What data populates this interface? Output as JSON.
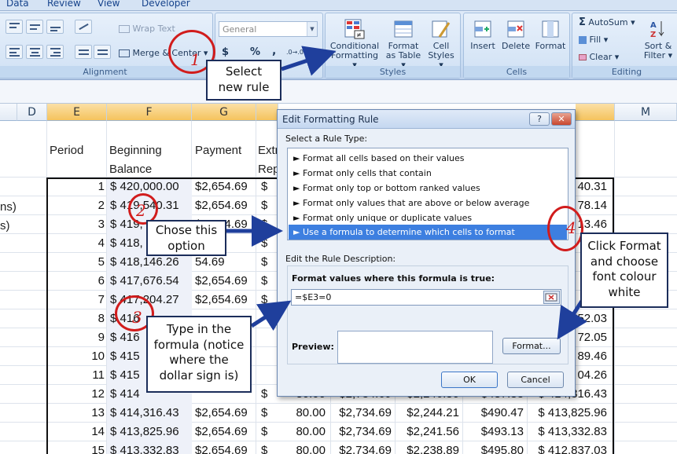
{
  "ribbon": {
    "tabs": [
      "Data",
      "Review",
      "View",
      "Developer"
    ],
    "alignment": {
      "wrap_text": "Wrap Text",
      "merge_center": "Merge & Center",
      "group_label": "Alignment"
    },
    "number": {
      "format_value": "General",
      "currency": "$",
      "percent": "%",
      "comma": ",",
      "decimals_inc": ".0→.00",
      "decimals_dec": ".00→.0"
    },
    "styles": {
      "conditional_formatting": [
        "Conditional",
        "Formatting ▾"
      ],
      "format_as_table": [
        "Format",
        "as Table ▾"
      ],
      "cell_styles": [
        "Cell",
        "Styles ▾"
      ],
      "group_label": "Styles"
    },
    "cells": {
      "insert": "Insert",
      "delete": "Delete",
      "format": "Format",
      "group_label": "Cells"
    },
    "editing": {
      "autosum": "AutoSum ▾",
      "fill": "Fill ▾",
      "clear": "Clear ▾",
      "sort_filter": [
        "Sort &",
        "Filter ▾"
      ],
      "find": [
        "Fin",
        "Sel"
      ],
      "group_label": "Editing"
    }
  },
  "sheet": {
    "columns": [
      "D",
      "E",
      "F",
      "G",
      "M"
    ],
    "headers": {
      "period": "Period",
      "beginning": "Beginning",
      "balance": "Balance",
      "payment": "Payment",
      "extra1": "Extr",
      "extra2": "Rep"
    },
    "left_labels": [
      "ns)",
      "s)"
    ],
    "rows": [
      {
        "period": "1",
        "balance": "$ 420,000.00",
        "payment": "$2,654.69",
        "c": "$",
        "m": "40.31"
      },
      {
        "period": "2",
        "balance": "$ 419,540.31",
        "payment": "$2,654.69",
        "c": "$",
        "m": "78.14"
      },
      {
        "period": "3",
        "balance": "$ 419,",
        "payment": "$2,654.69",
        "c": "$",
        "m": "13.46"
      },
      {
        "period": "4",
        "balance": "$ 418,",
        "payment": "4.69",
        "c": "$",
        "m": ""
      },
      {
        "period": "5",
        "balance": "$ 418,146.26",
        "payment": "54.69",
        "c": "$",
        "m": ""
      },
      {
        "period": "6",
        "balance": "$ 417,676.54",
        "payment": "$2,654.69",
        "c": "$",
        "m": ""
      },
      {
        "period": "7",
        "balance": "$ 417,204.27",
        "payment": "$2,654.69",
        "c": "$",
        "m": ""
      },
      {
        "period": "8",
        "balance": "$ 416",
        "payment": "",
        "c": "",
        "m": "52.03"
      },
      {
        "period": "9",
        "balance": "$ 416",
        "payment": "",
        "c": "",
        "m": "72.05"
      },
      {
        "period": "10",
        "balance": "$ 415",
        "payment": "",
        "c": "",
        "m": "89.46"
      },
      {
        "period": "11",
        "balance": "$ 415",
        "payment": "",
        "c": "",
        "m": "04.26"
      },
      {
        "period": "12",
        "balance": "$ 414",
        "payment": "",
        "c": "$",
        "m": "$ 414,316.43"
      },
      {
        "period": "13",
        "balance": "$ 414,316.43",
        "payment": "$2,654.69",
        "c": "$",
        "extra": "80.00",
        "total": "$2,734.69",
        "interest": "$2,244.21",
        "principal": "$490.47",
        "m": "$ 413,825.96"
      },
      {
        "period": "14",
        "balance": "$ 413,825.96",
        "payment": "$2,654.69",
        "c": "$",
        "extra": "80.00",
        "total": "$2,734.69",
        "interest": "$2,241.56",
        "principal": "$493.13",
        "m": "$ 413,332.83"
      },
      {
        "period": "15",
        "balance": "$ 413,332.83",
        "payment": "$2,654.69",
        "c": "$",
        "extra": "80.00",
        "total": "$2,734.69",
        "interest": "$2,238.89",
        "principal": "$495.80",
        "m": "$ 412,837.03"
      }
    ],
    "row12_extra": {
      "extra": "80.00",
      "total": "$2,734.69",
      "interest": "$2,246.80",
      "principal": "$487.83"
    }
  },
  "dialog": {
    "title": "Edit Formatting Rule",
    "help": "?",
    "close": "✕",
    "select_label": "Select a Rule Type:",
    "rules": [
      "► Format all cells based on their values",
      "► Format only cells that contain",
      "► Format only top or bottom ranked values",
      "► Format only values that are above or below average",
      "► Format only unique or duplicate values",
      "► Use a formula to determine which cells to format"
    ],
    "edit_label": "Edit the Rule Description:",
    "formula_label": "Format values where this formula is true:",
    "formula_value": "=$E3=0",
    "preview_label": "Preview:",
    "format_btn": "Format...",
    "ok_btn": "OK",
    "cancel_btn": "Cancel"
  },
  "annotations": {
    "step1": {
      "num": "1",
      "text": "Select new rule"
    },
    "step2": {
      "num": "2",
      "text": "Chose this option"
    },
    "step3": {
      "num": "3",
      "text": "Type in the formula (notice where the dollar sign is)"
    },
    "step4": {
      "num": "4",
      "text": "Click Format and choose font colour white"
    }
  },
  "colors": {
    "accent": "#3d7fe0",
    "annotation_red": "#d11c1c",
    "callout_border": "#1b2d5a",
    "header_selected": "#f5c35d"
  }
}
